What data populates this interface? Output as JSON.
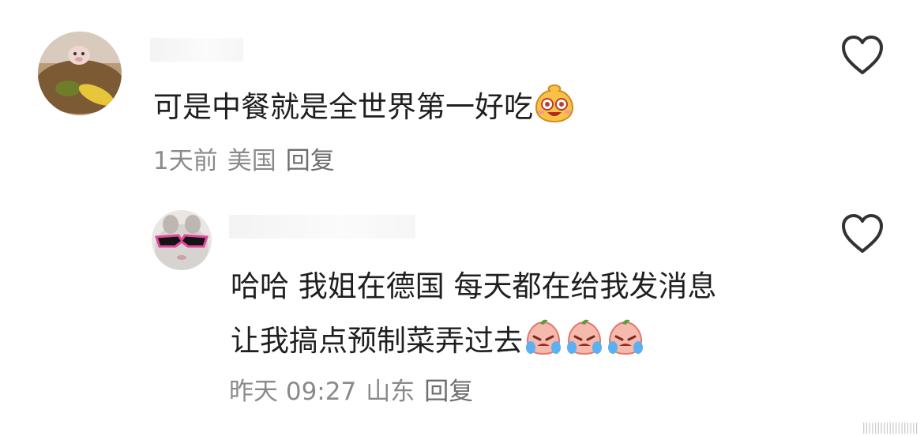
{
  "comments": [
    {
      "text": "可是中餐就是全世界第一好吃",
      "emoji": "happy-face-icon",
      "time": "1天前",
      "location": "美国",
      "reply_label": "回复"
    },
    {
      "line1": "哈哈 我姐在德国 每天都在给我发消息",
      "line2": "让我搞点预制菜弄过去",
      "emojis": [
        "crying-face-icon",
        "crying-face-icon",
        "crying-face-icon"
      ],
      "time": "昨天 09:27",
      "location": "山东",
      "reply_label": "回复"
    }
  ],
  "watermark": "|||||||||||||||||||"
}
